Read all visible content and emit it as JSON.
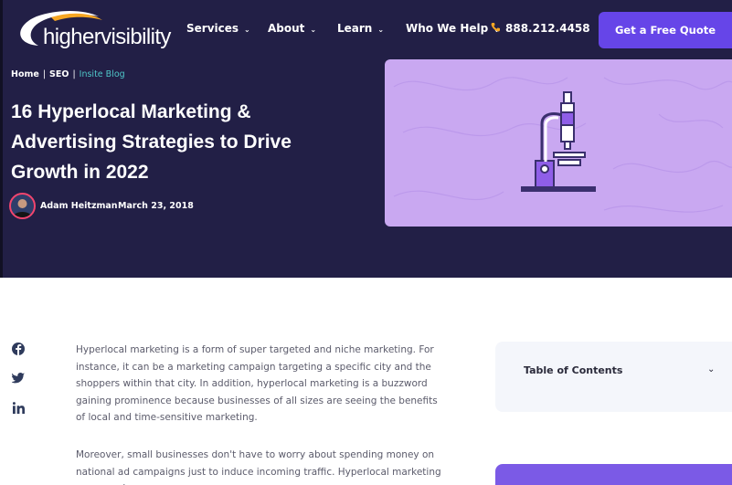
{
  "header": {
    "logo_text": "highervisibility",
    "nav": [
      {
        "label": "Services"
      },
      {
        "label": "About"
      },
      {
        "label": "Learn"
      },
      {
        "label": "Who We Help"
      }
    ],
    "phone": "888.212.4458",
    "cta_label": "Get a Free Quote"
  },
  "breadcrumb": {
    "items": [
      "Home",
      "SEO",
      "Insite Blog"
    ],
    "separator": "|"
  },
  "article": {
    "title_lines": [
      "16 Hyperlocal Marketing &",
      "Advertising Strategies to Drive",
      "Growth in 2022"
    ],
    "author": "Adam Heitzman",
    "date": "March 23, 2018",
    "paragraphs": [
      "Hyperlocal marketing is a form of super targeted and niche marketing. For instance, it can be a marketing campaign targeting a specific city and the shoppers within that city. In addition, hyperlocal marketing is a buzzword gaining prominence because businesses of all sizes are seeing the benefits of local and time-sensitive marketing.",
      "Moreover, small businesses don't have to worry about spending money on national ad campaigns just to induce incoming traffic. Hyperlocal marketing can even be"
    ]
  },
  "sidebar": {
    "toc_title": "Table of Contents"
  },
  "social": [
    "facebook-icon",
    "twitter-icon",
    "linkedin-icon"
  ],
  "colors": {
    "hero_bg": "#221f46",
    "cta": "#6645e8",
    "accent_teal": "#4fc6c8",
    "hero_image_bg": "#c9a8f1"
  }
}
